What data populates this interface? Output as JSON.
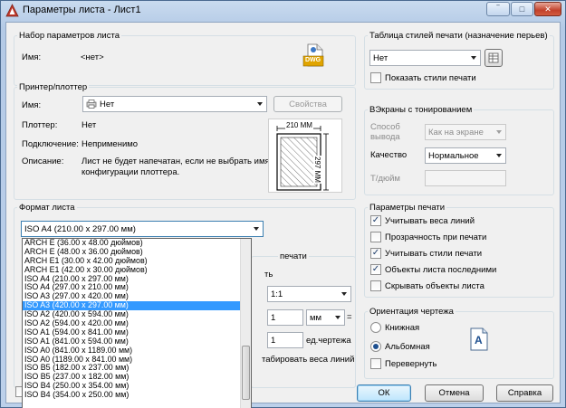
{
  "window": {
    "title": "Параметры листа - Лист1",
    "close_symbol": "✕",
    "minimize_symbol": "‾",
    "maximize_symbol": "□"
  },
  "page_setup": {
    "group_title": "Набор параметров листа",
    "name_label": "Имя:",
    "name_value": "<нет>",
    "dwg_icon_text": "DWG"
  },
  "plotter": {
    "group_title": "Принтер/плоттер",
    "name_label": "Имя:",
    "name_value": "Нет",
    "properties_button": "Свойства",
    "plotter_label": "Плоттер:",
    "plotter_value": "Нет",
    "connection_label": "Подключение:",
    "connection_value": "Неприменимо",
    "description_label": "Описание:",
    "description_line1": "Лист не будет напечатан, если не выбрать имя",
    "description_line2": "конфигурации плоттера.",
    "preview_width": "210 ММ",
    "preview_height": "297 ММ"
  },
  "paper": {
    "group_title": "Формат листа",
    "selected": "ISO A4 (210.00 x 297.00 мм)",
    "options": [
      "ARCH E (36.00 x 48.00 дюймов)",
      "ARCH E (48.00 x 36.00 дюймов)",
      "ARCH E1 (30.00 x 42.00 дюймов)",
      "ARCH E1 (42.00 x 30.00 дюймов)",
      "ISO A4 (210.00 x 297.00 мм)",
      "ISO A4 (297.00 x 210.00 мм)",
      "ISO A3 (297.00 x 420.00 мм)",
      "ISO A3 (420.00 x 297.00 мм)",
      "ISO A2 (420.00 x 594.00 мм)",
      "ISO A2 (594.00 x 420.00 мм)",
      "ISO A1 (594.00 x 841.00 мм)",
      "ISO A1 (841.00 x 594.00 мм)",
      "ISO A0 (841.00 x 1189.00 мм)",
      "ISO A0 (1189.00 x 841.00 мм)",
      "ISO B5 (182.00 x 237.00 мм)",
      "ISO B5 (237.00 x 182.00 мм)",
      "ISO B4 (250.00 x 354.00 мм)",
      "ISO B4 (354.00 x 250.00 мм)"
    ],
    "highlighted_index": 7
  },
  "scale": {
    "group_title_fragment": "печати",
    "fragment_label": "ть",
    "scale_value": "1:1",
    "value1": "1",
    "unit": "мм",
    "equals": "=",
    "value2": "1",
    "unit2": "ед.чертежа",
    "lineweights_fragment": "табировать веса линий"
  },
  "plot_style": {
    "group_title": "Таблица стилей печати (назначение перьев)",
    "value": "Нет",
    "show_styles_label": "Показать стили печати",
    "show_styles_checked": false
  },
  "shaded": {
    "group_title": "ВЭкраны с тонированием",
    "shade_label_line1": "Способ",
    "shade_label_line2": "вывода",
    "shade_value": "Как на экране",
    "quality_label": "Качество",
    "quality_value": "Нормальное",
    "dpi_label": "Т/дюйм",
    "dpi_value": ""
  },
  "plot_options": {
    "group_title": "Параметры печати",
    "items": [
      {
        "label": "Учитывать веса линий",
        "checked": true
      },
      {
        "label": "Прозрачность при печати",
        "checked": false
      },
      {
        "label": "Учитывать стили печати",
        "checked": true
      },
      {
        "label": "Объекты листа последними",
        "checked": true
      },
      {
        "label": "Скрывать объекты листа",
        "checked": false
      }
    ],
    "check_mark": "✓"
  },
  "orientation": {
    "group_title": "Ориентация чертежа",
    "portrait_label": "Книжная",
    "landscape_label": "Альбомная",
    "landscape_selected": true,
    "upside_down_label": "Перевернуть",
    "upside_down_checked": false,
    "icon_letter": "A"
  },
  "footer": {
    "ok": "ОК",
    "cancel": "Отмена",
    "help": "Справка"
  }
}
